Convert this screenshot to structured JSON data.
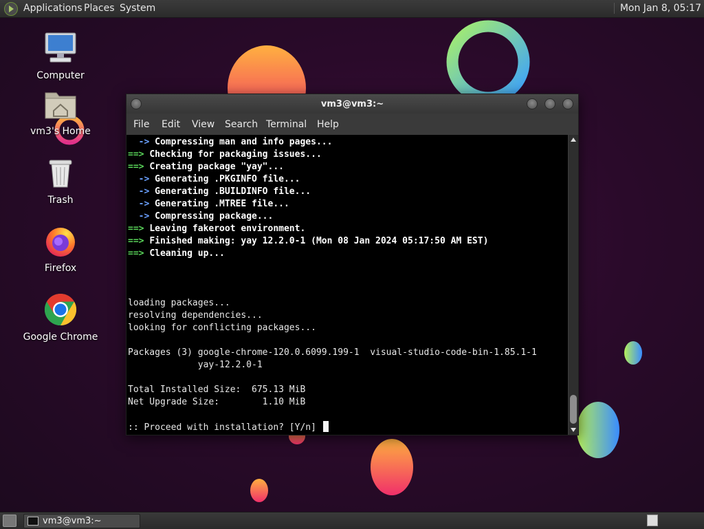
{
  "top_panel": {
    "menus": [
      "Applications",
      "Places",
      "System"
    ],
    "clock": "Mon Jan  8, 05:17"
  },
  "desktop_icons": [
    {
      "label": "Computer",
      "icon": "computer-icon"
    },
    {
      "label": "vm3's Home",
      "icon": "home-folder-icon"
    },
    {
      "label": "Trash",
      "icon": "trash-icon"
    },
    {
      "label": "Firefox",
      "icon": "firefox-icon"
    },
    {
      "label": "Google Chrome",
      "icon": "chrome-icon"
    }
  ],
  "window": {
    "title": "vm3@vm3:~",
    "menu": [
      "File",
      "Edit",
      "View",
      "Search",
      "Terminal",
      "Help"
    ]
  },
  "terminal_lines": [
    {
      "prefix": "  -> ",
      "text": "Compressing man and info pages..."
    },
    {
      "prefix": "==> ",
      "text": "Checking for packaging issues..."
    },
    {
      "prefix": "==> ",
      "text": "Creating package \"yay\"..."
    },
    {
      "prefix": "  -> ",
      "text": "Generating .PKGINFO file..."
    },
    {
      "prefix": "  -> ",
      "text": "Generating .BUILDINFO file..."
    },
    {
      "prefix": "  -> ",
      "text": "Generating .MTREE file..."
    },
    {
      "prefix": "  -> ",
      "text": "Compressing package..."
    },
    {
      "prefix": "==> ",
      "text": "Leaving fakeroot environment."
    },
    {
      "prefix": "==> ",
      "text": "Finished making: yay 12.2.0-1 (Mon 08 Jan 2024 05:17:50 AM EST)"
    },
    {
      "prefix": "==> ",
      "text": "Cleaning up..."
    },
    {
      "prefix": "",
      "text": ""
    },
    {
      "prefix": "",
      "text": ""
    },
    {
      "prefix": "",
      "text": ""
    },
    {
      "prefix": "",
      "text": "loading packages..."
    },
    {
      "prefix": "",
      "text": "resolving dependencies..."
    },
    {
      "prefix": "",
      "text": "looking for conflicting packages..."
    },
    {
      "prefix": "",
      "text": ""
    },
    {
      "prefix": "",
      "text": "Packages (3) google-chrome-120.0.6099.199-1  visual-studio-code-bin-1.85.1-1"
    },
    {
      "prefix": "",
      "text": "             yay-12.2.0-1"
    },
    {
      "prefix": "",
      "text": ""
    },
    {
      "prefix": "",
      "text": "Total Installed Size:  675.13 MiB"
    },
    {
      "prefix": "",
      "text": "Net Upgrade Size:        1.10 MiB"
    },
    {
      "prefix": "",
      "text": ""
    },
    {
      "prefix": "",
      "text": ":: Proceed with installation? [Y/n] "
    }
  ],
  "taskbar": {
    "task_label": "vm3@vm3:~"
  },
  "colors": {
    "arrow_green": "#5ad65a",
    "arrow_blue": "#6aa0ff",
    "terminal_bg": "#000000"
  }
}
